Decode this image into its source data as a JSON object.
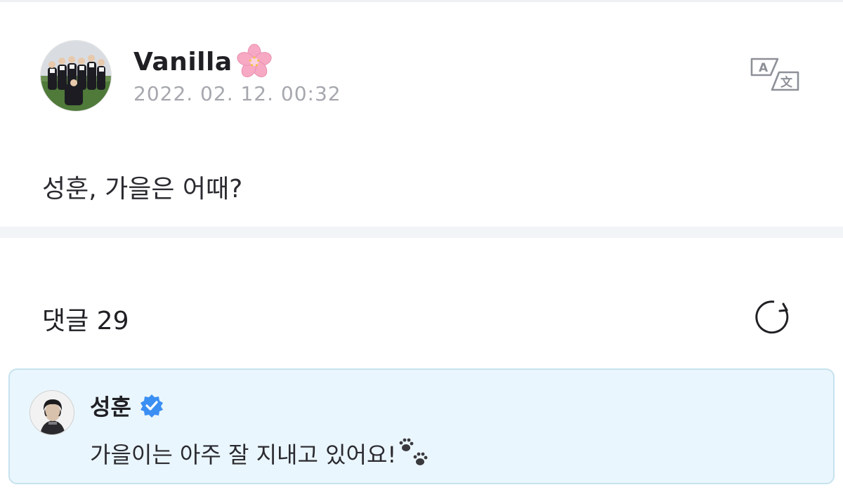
{
  "post": {
    "author": "Vanilla",
    "author_emoji": "cherry-blossom-emoji",
    "timestamp": "2022. 02. 12. 00:32",
    "body": "성훈, 가을은 어때?",
    "translate_icon": "translate-icon"
  },
  "comments": {
    "title": "댓글 29",
    "refresh_icon": "refresh-icon",
    "items": [
      {
        "author": "성훈",
        "verified": true,
        "text": "가을이는 아주 잘 지내고 있어요!",
        "text_emoji": "paw-prints-emoji"
      }
    ]
  },
  "colors": {
    "text": "#1f1f24",
    "muted": "#a6a8ae",
    "divider": "#f3f4f8",
    "comment_bg": "#eaf6fd",
    "comment_border": "#c6e2ef",
    "verified": "#3b8ff3"
  }
}
